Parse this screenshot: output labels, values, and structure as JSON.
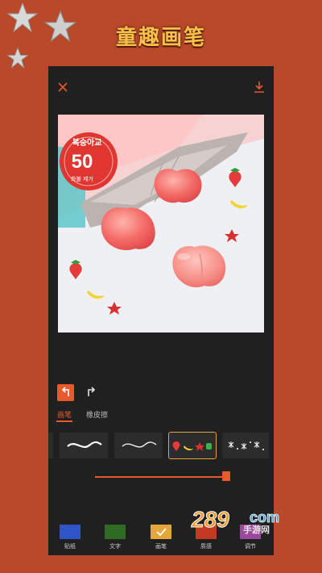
{
  "banner": {
    "title": "童趣画笔"
  },
  "editor": {
    "photo_text": {
      "line1": "복숭아교",
      "line2": "50",
      "line3": "화불 제거"
    },
    "tabs": [
      {
        "label": "画笔",
        "active": true
      },
      {
        "label": "橡皮擦",
        "active": false
      }
    ],
    "brush_selected_index": 2,
    "slider_value": 0.96,
    "tools": [
      {
        "label": "贴纸",
        "color": "#2f55c8",
        "checked": false
      },
      {
        "label": "文字",
        "color": "#2f6b23",
        "checked": false
      },
      {
        "label": "画笔",
        "color": "#e3a63b",
        "checked": true
      },
      {
        "label": "质感",
        "color": "#c23a22",
        "checked": false
      },
      {
        "label": "调节",
        "color": "#9a4a9a",
        "checked": false
      }
    ]
  },
  "watermark": {
    "logo": "289",
    "suffix": "com",
    "site": "手游网"
  }
}
